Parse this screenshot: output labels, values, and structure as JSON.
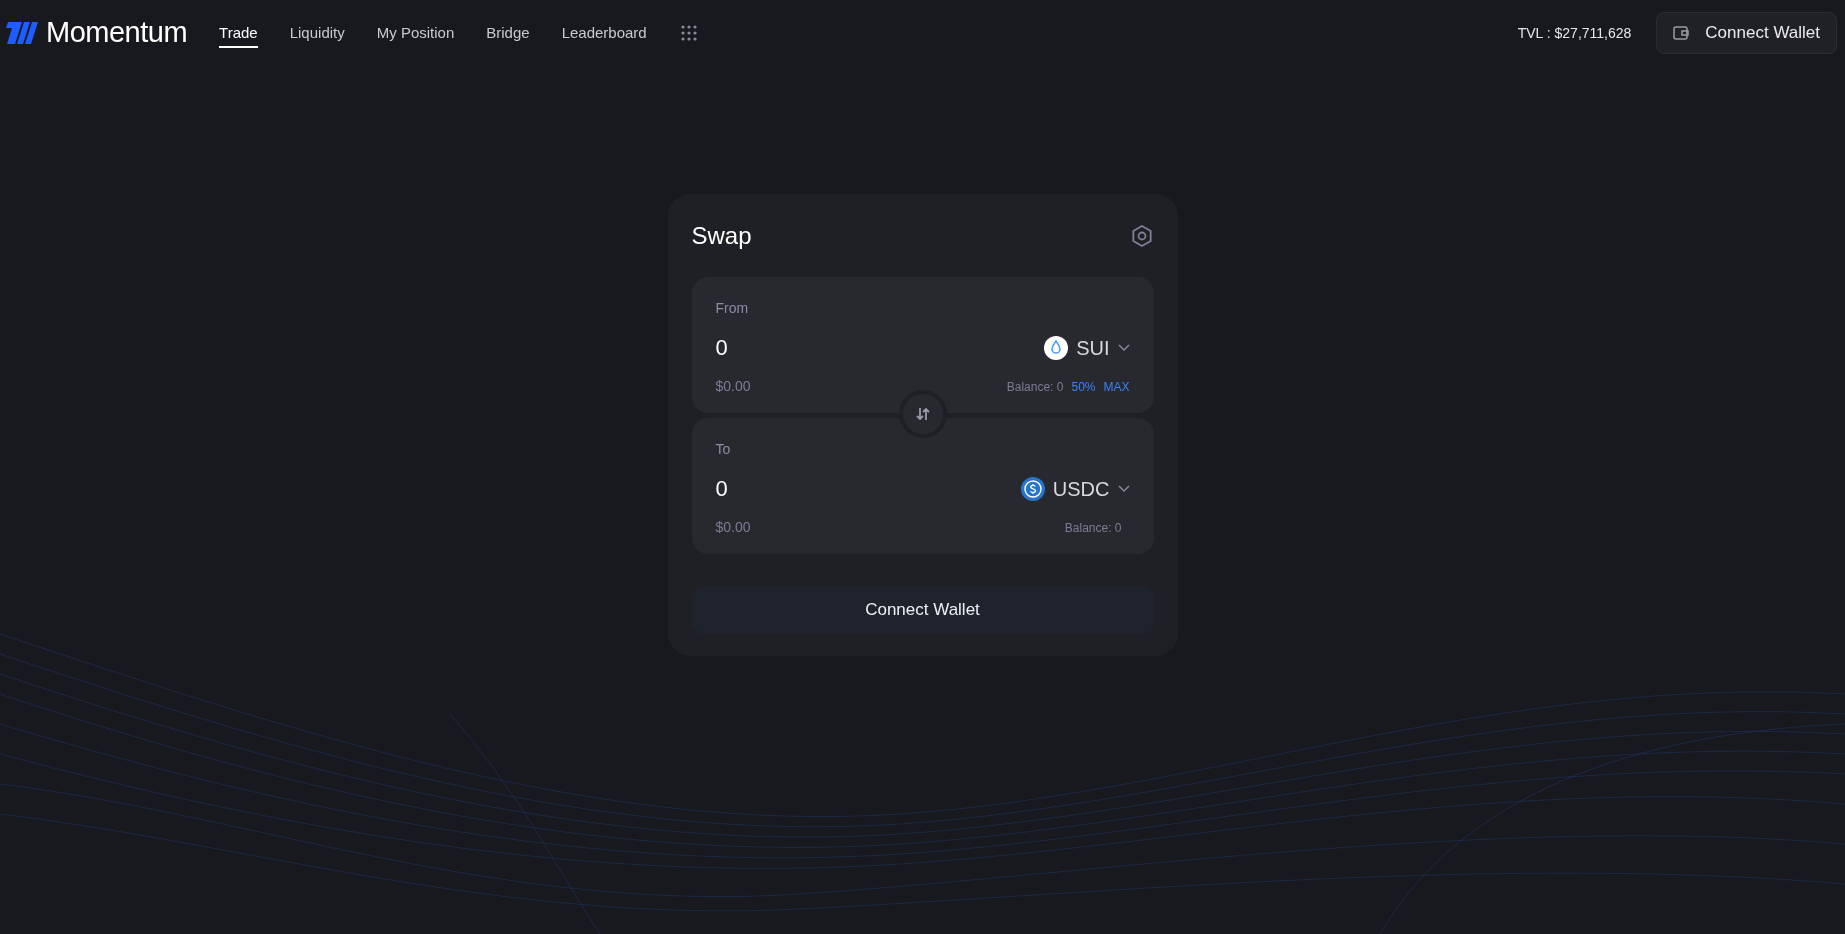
{
  "brand": {
    "name": "Momentum"
  },
  "nav": [
    {
      "label": "Trade",
      "selected": true
    },
    {
      "label": "Liquidity",
      "selected": false
    },
    {
      "label": "My Position",
      "selected": false
    },
    {
      "label": "Bridge",
      "selected": false
    },
    {
      "label": "Leaderboard",
      "selected": false
    }
  ],
  "tvl": "TVL : $27,711,628",
  "header_button": "Connect Wallet",
  "swap": {
    "title": "Swap",
    "panels": [
      {
        "label": "From",
        "amount": "0",
        "usd": "$0.00",
        "token": {
          "symbol": "SUI",
          "kind": "sui"
        },
        "balance": "Balance: 0",
        "actions": [
          "50%",
          "MAX"
        ]
      },
      {
        "label": "To",
        "amount": "0",
        "usd": "$0.00",
        "token": {
          "symbol": "USDC",
          "kind": "usdc"
        },
        "balance": "Balance: 0"
      }
    ],
    "button": "Connect Wallet"
  }
}
